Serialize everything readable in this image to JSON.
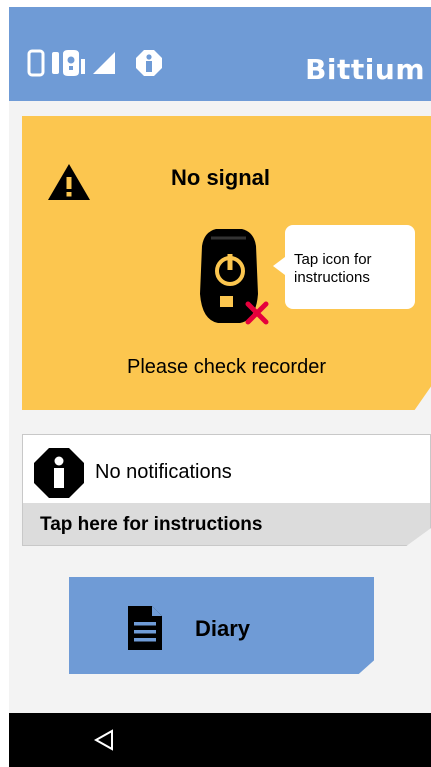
{
  "header": {
    "brand": "Bittium",
    "icons": [
      "phone-icon",
      "recorder-status-icon",
      "signal-strength-icon",
      "info-icon"
    ]
  },
  "signal_card": {
    "title": "No signal",
    "bubble_text": "Tap icon for instructions",
    "message": "Please check recorder",
    "icons": [
      "warning-icon",
      "recorder-no-signal-icon"
    ]
  },
  "notifications": {
    "text": "No notifications",
    "footer": "Tap here for instructions",
    "icon": "info-icon"
  },
  "diary": {
    "label": "Diary",
    "icon": "document-icon"
  },
  "navbar": {
    "icons": [
      "back-icon"
    ]
  },
  "colors": {
    "header_blue": "#6f9bd6",
    "warning_yellow": "#fcc64f",
    "error_red": "#e6003c",
    "background": "#f3f3f3"
  }
}
